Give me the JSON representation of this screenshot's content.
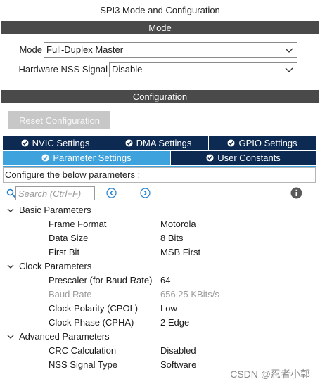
{
  "window": {
    "title": "SPI3 Mode and Configuration"
  },
  "mode_section": {
    "header": "Mode",
    "mode_label": "Mode",
    "mode_value": "Full-Duplex Master",
    "nss_label": "Hardware NSS Signal",
    "nss_value": "Disable"
  },
  "config_section": {
    "header": "Configuration",
    "reset_label": "Reset Configuration",
    "tabs": [
      {
        "label": "NVIC Settings",
        "active": false
      },
      {
        "label": "DMA Settings",
        "active": false
      },
      {
        "label": "GPIO Settings",
        "active": false
      },
      {
        "label": "Parameter Settings",
        "active": true
      },
      {
        "label": "User Constants",
        "active": false
      }
    ],
    "description": "Configure the below parameters :",
    "search_placeholder": "Search (Ctrl+F)"
  },
  "groups": [
    {
      "name": "Basic Parameters",
      "params": [
        {
          "name": "Frame Format",
          "value": "Motorola"
        },
        {
          "name": "Data Size",
          "value": "8 Bits"
        },
        {
          "name": "First Bit",
          "value": "MSB First"
        }
      ]
    },
    {
      "name": "Clock Parameters",
      "params": [
        {
          "name": "Prescaler (for Baud Rate)",
          "value": "64"
        },
        {
          "name": "Baud Rate",
          "value": "656.25 KBits/s"
        },
        {
          "name": "Clock Polarity (CPOL)",
          "value": "Low"
        },
        {
          "name": "Clock Phase (CPHA)",
          "value": "2 Edge"
        }
      ]
    },
    {
      "name": "Advanced Parameters",
      "params": [
        {
          "name": "CRC Calculation",
          "value": "Disabled"
        },
        {
          "name": "NSS Signal Type",
          "value": "Software"
        }
      ]
    }
  ],
  "watermark": "CSDN @忍者小郭",
  "colors": {
    "section_bar": "#4a4a4a",
    "tab_dark": "#0d2a52",
    "tab_active": "#3ea2dc",
    "disabled_text": "#9c9c9c"
  }
}
